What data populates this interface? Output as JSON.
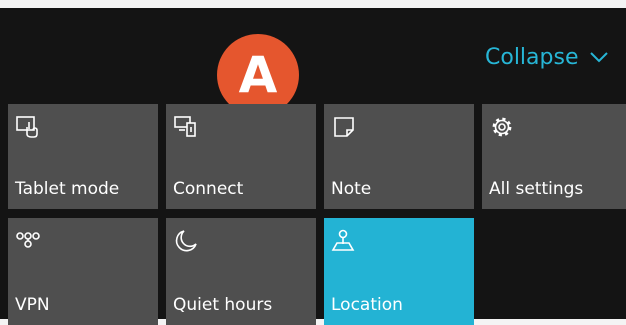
{
  "header": {
    "badge_letter": "A",
    "collapse_label": "Collapse",
    "accent_color": "#27b6d6",
    "badge_color": "#e5562e"
  },
  "tiles": [
    {
      "label": "Tablet mode",
      "icon": "tablet-mode-icon",
      "active": false
    },
    {
      "label": "Connect",
      "icon": "connect-icon",
      "active": false
    },
    {
      "label": "Note",
      "icon": "note-icon",
      "active": false
    },
    {
      "label": "All settings",
      "icon": "gear-icon",
      "active": false
    },
    {
      "label": "VPN",
      "icon": "vpn-icon",
      "active": false
    },
    {
      "label": "Quiet hours",
      "icon": "moon-icon",
      "active": false
    },
    {
      "label": "Location",
      "icon": "location-icon",
      "active": true
    }
  ],
  "colors": {
    "tile_bg": "#4f4f4f",
    "tile_active_bg": "#23b3d4",
    "panel_bg": "#141414"
  }
}
